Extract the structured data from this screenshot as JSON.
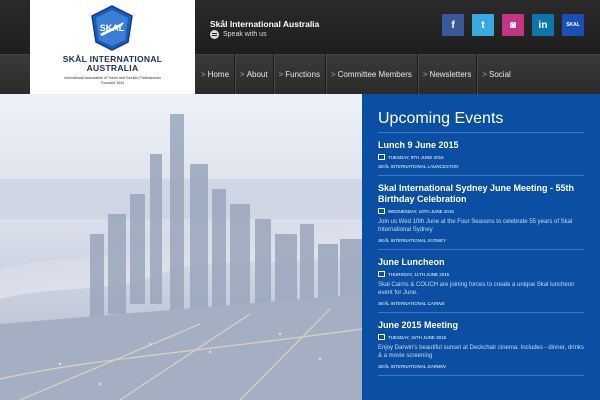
{
  "logo": {
    "badge_text": "SKAL",
    "name_line1": "SKÅL INTERNATIONAL",
    "name_line2": "AUSTRALIA",
    "tagline1": "International Association of Travel and Tourism Professionals",
    "tagline2": "Founded 1934"
  },
  "header": {
    "site_title": "Skål International Australia",
    "speak_label": "Speak with us"
  },
  "socials": [
    {
      "name": "facebook",
      "glyph": "f",
      "color": "#3b5998"
    },
    {
      "name": "twitter",
      "glyph": "t",
      "color": "#39a9e0"
    },
    {
      "name": "instagram",
      "glyph": "◙",
      "color": "#c13584"
    },
    {
      "name": "linkedin",
      "glyph": "in",
      "color": "#0e76a8"
    },
    {
      "name": "skal",
      "glyph": "SKAL",
      "color": "#1a4fb5"
    }
  ],
  "nav": {
    "chevron": ">",
    "items": [
      "Home",
      "About",
      "Functions",
      "Committee Members",
      "Newsletters",
      "Social"
    ]
  },
  "events": {
    "heading": "Upcoming Events",
    "items": [
      {
        "title": "Lunch 9 June 2015",
        "date": "TUESDAY, 9TH JUNE 2015",
        "description": "",
        "location": "SKÅL INTERNATIONAL LAUNCESTON"
      },
      {
        "title": "Skal International Sydney June Meeting - 55th Birthday Celebration",
        "date": "WEDNESDAY, 10TH JUNE 2015",
        "description": "Join us Wed 10th June at the Four Seasons to celebrate 55 years of Skal International Sydney",
        "location": "SKÅL INTERNATIONAL SYDNEY"
      },
      {
        "title": "June Luncheon",
        "date": "THURSDAY, 11TH JUNE 2015",
        "description": "Skal Cairns & COUCH are joining forces to create a unique Skal luncheon event for June.",
        "location": "SKÅL INTERNATIONAL CAIRNS"
      },
      {
        "title": "June 2015 Meeting",
        "date": "TUESDAY, 16TH JUNE 2015",
        "description": "Enjoy Darwin's beautiful sunset at Deckchair cinema. Includes - dinner, drinks & a movie screening",
        "location": "SKÅL INTERNATIONAL DARWIN"
      }
    ]
  }
}
